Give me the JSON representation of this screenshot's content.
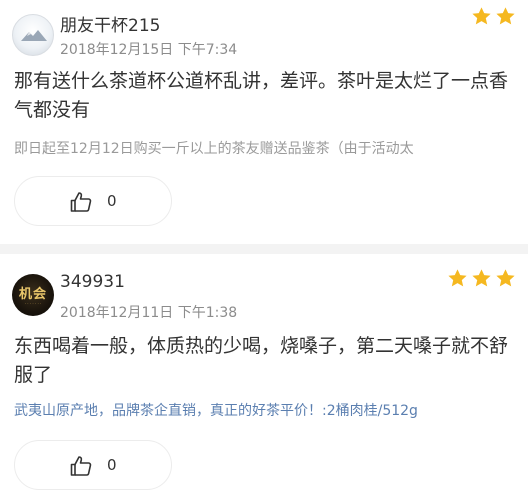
{
  "reviews": [
    {
      "username": "朋友干杯215",
      "timestamp": "2018年12月15日 下午7:34",
      "rating": 2,
      "content": "那有送什么茶道杯公道杯乱讲，差评。茶叶是太烂了一点香气都没有",
      "promo": "即日起至12月12日购买一斤以上的茶友赠送品鉴茶（由于活动太",
      "likes": "0",
      "avatar_icon": "mountain-avatar-icon"
    },
    {
      "username": "349931",
      "timestamp": "2018年12月11日 下午1:38",
      "rating": 3,
      "content": "东西喝着一般，体质热的少喝，烧嗓子，第二天嗓子就不舒服了",
      "promo": "武夷山原产地，品牌茶企直销，真正的好茶平价！:2桶肉桂/512g",
      "likes": "0",
      "avatar_icon": "jihui-logo-avatar",
      "avatar_text": "机会"
    }
  ],
  "colors": {
    "star": "#f5b820",
    "promo_link": "#5b7fb0",
    "promo_muted": "#9a9a9a",
    "divider": "#f3f3f3"
  }
}
